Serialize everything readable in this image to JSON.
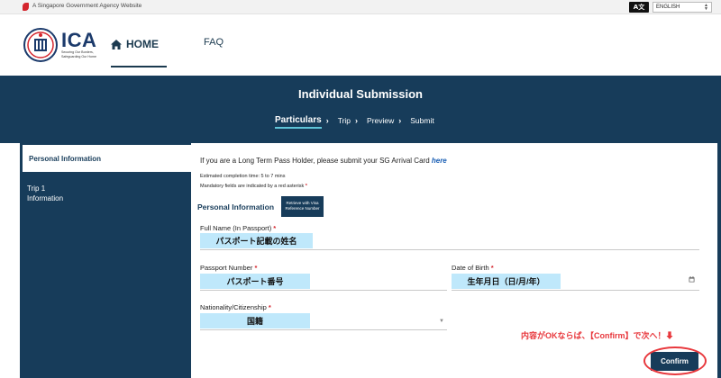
{
  "gov_bar": {
    "text": "A Singapore Government Agency Website",
    "language_icon": "A文",
    "language_value": "ENGLISH"
  },
  "header": {
    "logo_text": "ICA",
    "logo_tagline": "Securing Our Borders, Safeguarding Our Home",
    "nav_home": "HOME",
    "nav_faq": "FAQ"
  },
  "banner": {
    "title": "Individual Submission",
    "steps": [
      {
        "label": "Particulars",
        "chevron": "›"
      },
      {
        "label": "Trip",
        "chevron": "›"
      },
      {
        "label": "Preview",
        "chevron": "›"
      },
      {
        "label": "Submit",
        "chevron": ""
      }
    ]
  },
  "sidebar": {
    "items": [
      {
        "label": "Personal Information"
      },
      {
        "label": "Trip 1 Information"
      }
    ]
  },
  "form": {
    "ltp_notice": "If you are a Long Term Pass Holder, please submit your SG Arrival Card ",
    "ltp_link": "here",
    "estimated_time": "Estimated completion time: 5 to 7 mins",
    "mandatory_note": "Mandatory fields are indicated by a red asterisk ",
    "asterisk": "*",
    "section_title": "Personal Information",
    "retrieve_button": "Retrieve with Visa Reference Number",
    "full_name": {
      "label": "Full Name (In Passport) ",
      "value": "パスポート記載の姓名"
    },
    "passport_number": {
      "label": "Passport Number ",
      "value": "パスポート番号"
    },
    "date_of_birth": {
      "label": "Date of Birth ",
      "value": "生年月日（日/月/年）"
    },
    "nationality": {
      "label": "Nationality/Citizenship ",
      "value": "国籍"
    }
  },
  "annotation": "内容がOKならば、【Confirm】で次へ！⬇",
  "confirm_button": "Confirm",
  "colors": {
    "navy": "#173c5a",
    "highlight": "#bfe8fb",
    "annotation_red": "#e8383d",
    "link_blue": "#1a5fb4"
  },
  "icons": [
    "lion-head-icon",
    "translate-icon",
    "home-icon",
    "chevron-right-icon",
    "calendar-icon",
    "dropdown-arrow-icon"
  ]
}
